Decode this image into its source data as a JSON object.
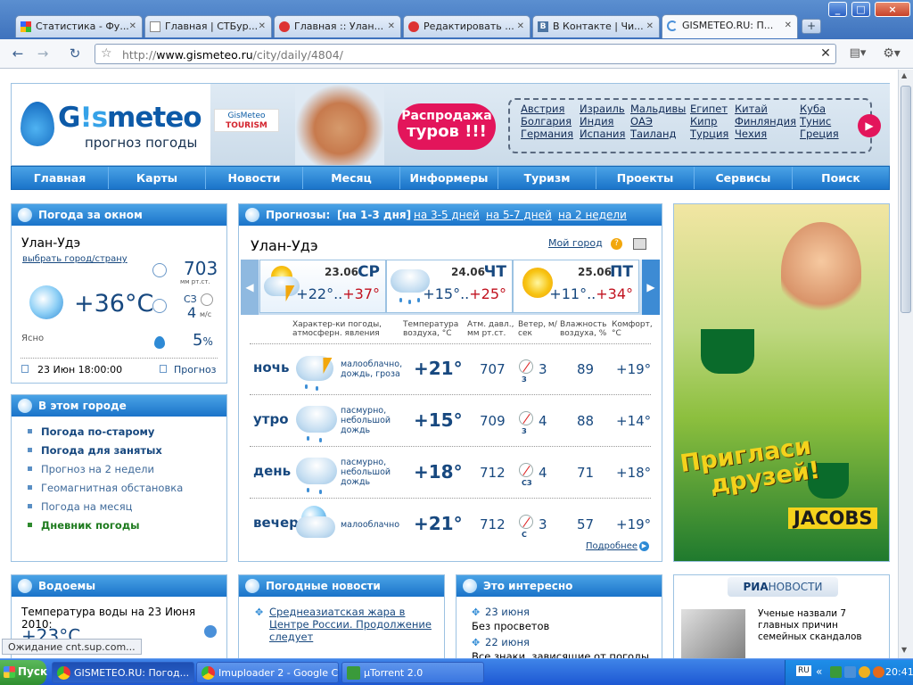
{
  "browser": {
    "tabs": [
      {
        "title": "Статистика - Фу..."
      },
      {
        "title": "Главная | СТБур..."
      },
      {
        "title": "Главная :: Улан..."
      },
      {
        "title": "Редактировать ..."
      },
      {
        "title": "В Контакте | Чи..."
      },
      {
        "title": "GISMETEO.RU: П..."
      }
    ],
    "new_tab_label": "+",
    "window_buttons": [
      "_",
      "□",
      "×"
    ],
    "url_prefix": "http://",
    "url_host": "www.gismeteo.ru",
    "url_path": "/city/daily/4804/",
    "status_text": "Ожидание cnt.sup.com..."
  },
  "site": {
    "logo_name_a": "G",
    "logo_name_b": "!s",
    "logo_name_c": "meteo",
    "logo_sub": "прогноз погоды",
    "banner": {
      "tourism_a": "GisMeteo",
      "tourism_b": "TOURISM",
      "sale_a": "Распродажа",
      "sale_b": "туров !!!",
      "countries": [
        "Австрия",
        "Израиль",
        "Мальдивы",
        "Египет",
        "Китай",
        "Куба",
        "Болгария",
        "Индия",
        "ОАЭ",
        "Кипр",
        "Финляндия",
        "Тунис",
        "Германия",
        "Испания",
        "Таиланд",
        "Турция",
        "Чехия",
        "Греция"
      ]
    },
    "nav": [
      "Главная",
      "Карты",
      "Новости",
      "Месяц",
      "Информеры",
      "Туризм",
      "Проекты",
      "Сервисы",
      "Поиск"
    ]
  },
  "now": {
    "header": "Погода за окном",
    "city": "Улан-Удэ",
    "change_city": "выбрать город/страну",
    "pressure": "703",
    "pressure_unit": "мм рт.ст.",
    "temp": "+36°C",
    "wind_dir": "СЗ",
    "wind_speed": "4",
    "wind_unit": "м/с",
    "condition": "Ясно",
    "humidity": "5",
    "humidity_unit": "%",
    "time": "23 Июн 18:00:00",
    "forecast_link": "Прогноз"
  },
  "city": {
    "header": "В этом городе",
    "links": [
      "Погода по-старому",
      "Погода для занятых",
      "Прогноз на 2 недели",
      "Геомагнитная обстановка",
      "Погода на месяц",
      "Дневник погоды"
    ]
  },
  "forecast": {
    "header": "Прогнозы:",
    "tabs": [
      "[на 1-3 дня]",
      "на 3-5 дней",
      "на 5-7 дней",
      "на 2 недели"
    ],
    "city": "Улан-Удэ",
    "my_city": "Мой город",
    "days": [
      {
        "date": "23.06",
        "dow": "СР",
        "tmin": "+22°",
        "sep": "..",
        "tmax": "+37°"
      },
      {
        "date": "24.06",
        "dow": "ЧТ",
        "tmin": "+15°",
        "sep": "..",
        "tmax": "+25°"
      },
      {
        "date": "25.06",
        "dow": "ПТ",
        "tmin": "+11°",
        "sep": "..",
        "tmax": "+34°"
      }
    ],
    "columns": {
      "cond": "Характер-ки погоды, атмосферн. явления",
      "temp": "Температура воздуха, °С",
      "press": "Атм. давл., мм рт.ст.",
      "wind": "Ветер, м/сек",
      "hum": "Влажность воздуха, %",
      "comfort": "Комфорт, °С"
    },
    "rows": [
      {
        "tod": "ночь",
        "desc": "малооблачно, дождь, гроза",
        "t": "+21°",
        "p": "707",
        "ws": "3",
        "wd": "З",
        "h": "89",
        "c": "+19°"
      },
      {
        "tod": "утро",
        "desc": "пасмурно, небольшой дождь",
        "t": "+15°",
        "p": "709",
        "ws": "4",
        "wd": "З",
        "h": "88",
        "c": "+14°"
      },
      {
        "tod": "день",
        "desc": "пасмурно, небольшой дождь",
        "t": "+18°",
        "p": "712",
        "ws": "4",
        "wd": "СЗ",
        "h": "71",
        "c": "+18°"
      },
      {
        "tod": "вечер",
        "desc": "малооблачно",
        "t": "+21°",
        "p": "712",
        "ws": "3",
        "wd": "С",
        "h": "57",
        "c": "+19°"
      }
    ],
    "more": "Подробнее"
  },
  "ad": {
    "slogan_a": "Пригласи",
    "slogan_b": "друзей!",
    "brand": "JACOBS"
  },
  "water": {
    "header": "Водоемы",
    "text": "Температура воды на 23 Июня 2010:",
    "value": "+23°C"
  },
  "news": {
    "header": "Погодные новости",
    "item": "Среднеазиатская жара в Центре России. Продолжение следует"
  },
  "interesting": {
    "header": "Это интересно",
    "d1": "23 июня",
    "t1": "Без просветов",
    "d2": "22 июня",
    "t2": "Все знаки, зависящие от погоды"
  },
  "ria": {
    "logo_a": "РИА",
    "logo_b": "НОВОСТИ",
    "text": "Ученые назвали 7 главных причин семейных скандалов"
  },
  "taskbar": {
    "start": "Пуск",
    "items": [
      "GISMETEO.RU: Погод...",
      "Imuploader 2 - Google C...",
      "µTorrent 2.0"
    ],
    "lang": "RU",
    "clock": "20:41",
    "chevron": "«"
  },
  "colors": {
    "accent": "#1a73c9",
    "link": "#17487f",
    "max_temp": "#c1121f",
    "sale": "#e3155b"
  }
}
